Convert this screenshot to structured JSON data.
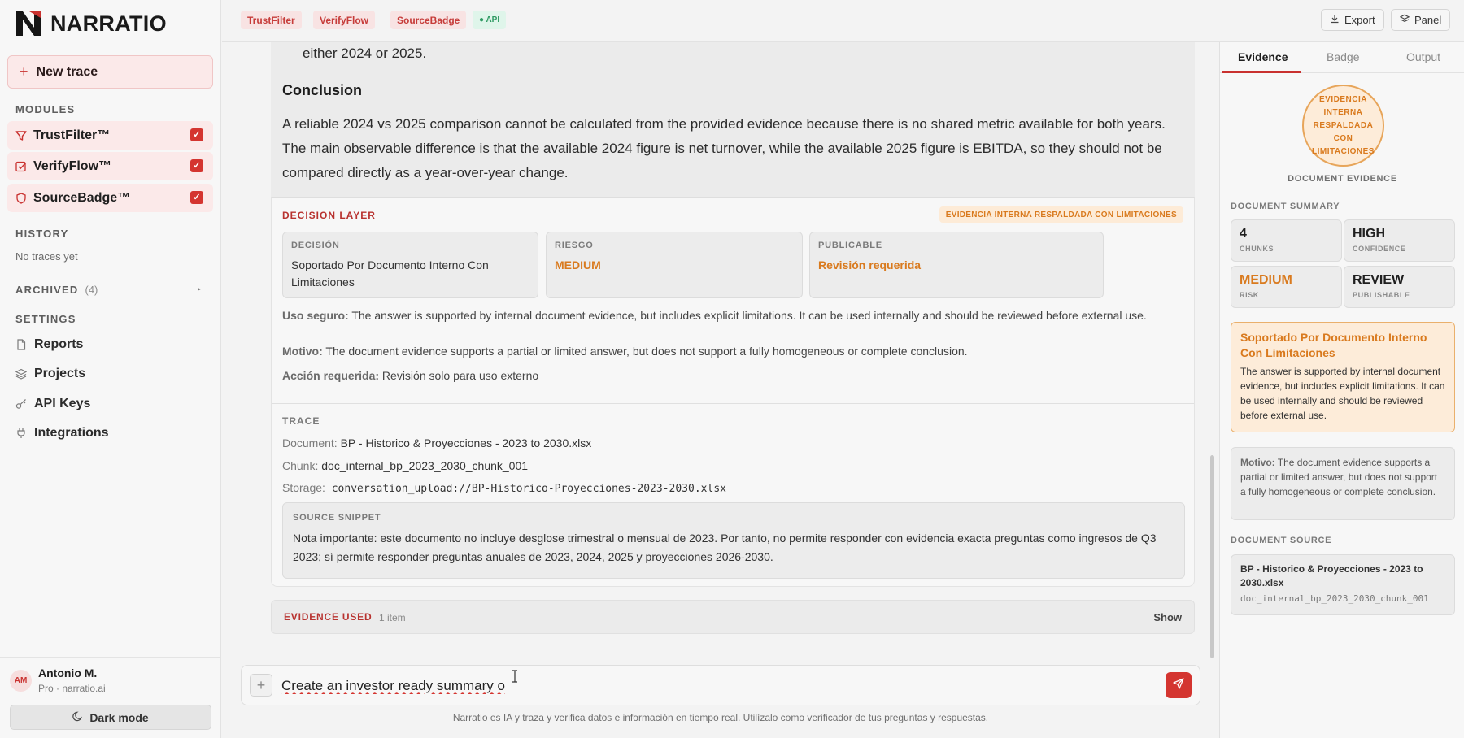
{
  "brand": {
    "name": "NARRATIO"
  },
  "sidebar": {
    "new_trace": "New trace",
    "modules_label": "MODULES",
    "modules": [
      {
        "label": "TrustFilter™",
        "icon": "filter-icon",
        "checked": true
      },
      {
        "label": "VerifyFlow™",
        "icon": "check-square-icon",
        "checked": true
      },
      {
        "label": "SourceBadge™",
        "icon": "shield-icon",
        "checked": true
      }
    ],
    "history_label": "HISTORY",
    "history_empty": "No traces yet",
    "archived_label": "ARCHIVED",
    "archived_count": "(4)",
    "settings_label": "SETTINGS",
    "nav": [
      {
        "label": "Reports",
        "icon": "document-icon"
      },
      {
        "label": "Projects",
        "icon": "layers-icon"
      },
      {
        "label": "API Keys",
        "icon": "key-icon"
      },
      {
        "label": "Integrations",
        "icon": "plug-icon"
      }
    ],
    "user": {
      "initials": "AM",
      "name": "Antonio M.",
      "plan": "Pro · narratio.ai"
    },
    "dark_mode": "Dark mode"
  },
  "topbar": {
    "tags": [
      "TrustFilter",
      "VerifyFlow",
      "SourceBadge"
    ],
    "api_tag": "● API",
    "export": "Export",
    "panel": "Panel"
  },
  "answer": {
    "trailing_text": "either 2024 or 2025.",
    "conclusion_heading": "Conclusion",
    "conclusion_text": "A reliable 2024 vs 2025 comparison cannot be calculated from the provided evidence because there is no shared metric available for both years. The main observable difference is that the available 2024 figure is net turnover, while the available 2025 figure is EBITDA, so they should not be compared directly as a year-over-year change."
  },
  "decision_layer": {
    "title": "DECISION LAYER",
    "badge": "EVIDENCIA INTERNA RESPALDADA CON LIMITACIONES",
    "boxes": [
      {
        "label": "DECISIÓN",
        "value": "Soportado Por Documento Interno Con Limitaciones"
      },
      {
        "label": "RIESGO",
        "value": "MEDIUM"
      },
      {
        "label": "PUBLICABLE",
        "value": "Revisión requerida"
      }
    ],
    "uso_label": "Uso seguro:",
    "uso_text": "The answer is supported by internal document evidence, but includes explicit limitations. It can be used internally and should be reviewed before external use.",
    "motivo_label": "Motivo:",
    "motivo_text": "The document evidence supports a partial or limited answer, but does not support a fully homogeneous or complete conclusion.",
    "accion_label": "Acción requerida:",
    "accion_text": "Revisión solo para uso externo"
  },
  "trace": {
    "title": "TRACE",
    "document_label": "Document:",
    "document": "BP - Historico & Proyecciones - 2023 to 2030.xlsx",
    "chunk_label": "Chunk:",
    "chunk": "doc_internal_bp_2023_2030_chunk_001",
    "storage_label": "Storage:",
    "storage": "conversation_upload://BP-Historico-Proyecciones-2023-2030.xlsx",
    "snippet_label": "SOURCE SNIPPET",
    "snippet": "Nota importante: este documento no incluye desglose trimestral o mensual de 2023. Por tanto, no permite responder con evidencia exacta preguntas como ingresos de Q3 2023; sí permite responder preguntas anuales de 2023, 2024, 2025 y proyecciones 2026-2030."
  },
  "evidence_used": {
    "label": "EVIDENCE USED",
    "count": "1 item",
    "show": "Show"
  },
  "composer": {
    "value": "Create an investor ready summary o",
    "disclaimer": "Narratio es IA y traza y verifica datos e información en tiempo real. Utilízalo como verificador de tus preguntas y respuestas."
  },
  "right_panel": {
    "tabs": [
      "Evidence",
      "Badge",
      "Output"
    ],
    "seal_text": "EVIDENCIA INTERNA RESPALDADA CON LIMITACIONES",
    "seal_caption": "DOCUMENT EVIDENCE",
    "summary_label": "DOCUMENT SUMMARY",
    "stats": [
      {
        "value": "4",
        "label": "CHUNKS"
      },
      {
        "value": "HIGH",
        "label": "CONFIDENCE"
      },
      {
        "value": "MEDIUM",
        "label": "RISK"
      },
      {
        "value": "REVIEW",
        "label": "PUBLISHABLE"
      }
    ],
    "decision_heading": "Soportado Por Documento Interno Con Limitaciones",
    "decision_body": "The answer is supported by internal document evidence, but includes explicit limitations. It can be used internally and should be reviewed before external use.",
    "motivo_label": "Motivo:",
    "motivo_text": "The document evidence supports a partial or limited answer, but does not support a fully homogeneous or complete conclusion.",
    "source_label": "DOCUMENT SOURCE",
    "source_name": "BP - Historico & Proyecciones - 2023 to 2030.xlsx",
    "source_chunk": "doc_internal_bp_2023_2030_chunk_001"
  },
  "colors": {
    "accent": "#d43530",
    "warning": "#d97a1e",
    "api_green": "#2e9a62"
  }
}
